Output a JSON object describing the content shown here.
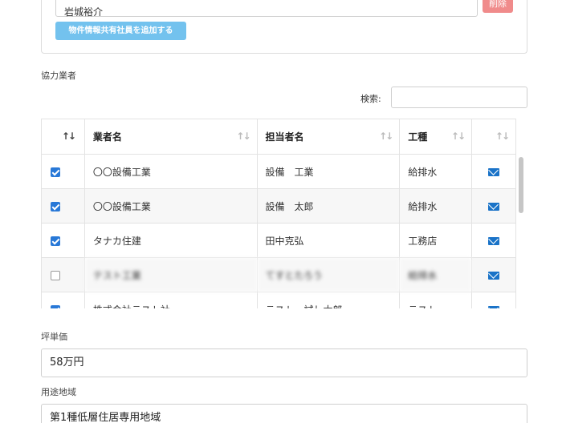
{
  "member": {
    "value": "岩城裕介",
    "delete_label": "削除",
    "add_label": "物件情報共有社員を追加する"
  },
  "contractors": {
    "section_label": "協力業者",
    "search_label": "検索:",
    "search_value": "",
    "columns": [
      "業者名",
      "担当者名",
      "工種"
    ],
    "rows": [
      {
        "checked": true,
        "company": "〇〇設備工業",
        "person": "設備　工業",
        "trade": "給排水"
      },
      {
        "checked": true,
        "company": "〇〇設備工業",
        "person": "設備　太郎",
        "trade": "給排水"
      },
      {
        "checked": true,
        "company": "タナカ住建",
        "person": "田中克弘",
        "trade": "工務店"
      },
      {
        "checked": false,
        "company": "テスト工業",
        "person": "てすとたろう",
        "trade": "給排水"
      },
      {
        "checked": true,
        "company": "株式会社テスト社",
        "person": "テスト　試し太郎",
        "trade": "テスト"
      }
    ]
  },
  "unit_price": {
    "label": "坪単価",
    "value": "58万円"
  },
  "zoning": {
    "label": "用途地域",
    "value": "第1種低層住居専用地域"
  },
  "colors": {
    "delete": "#f08b8b",
    "add": "#73c2ee",
    "checkbox": "#2878d7",
    "mail": "#1a73c8"
  }
}
